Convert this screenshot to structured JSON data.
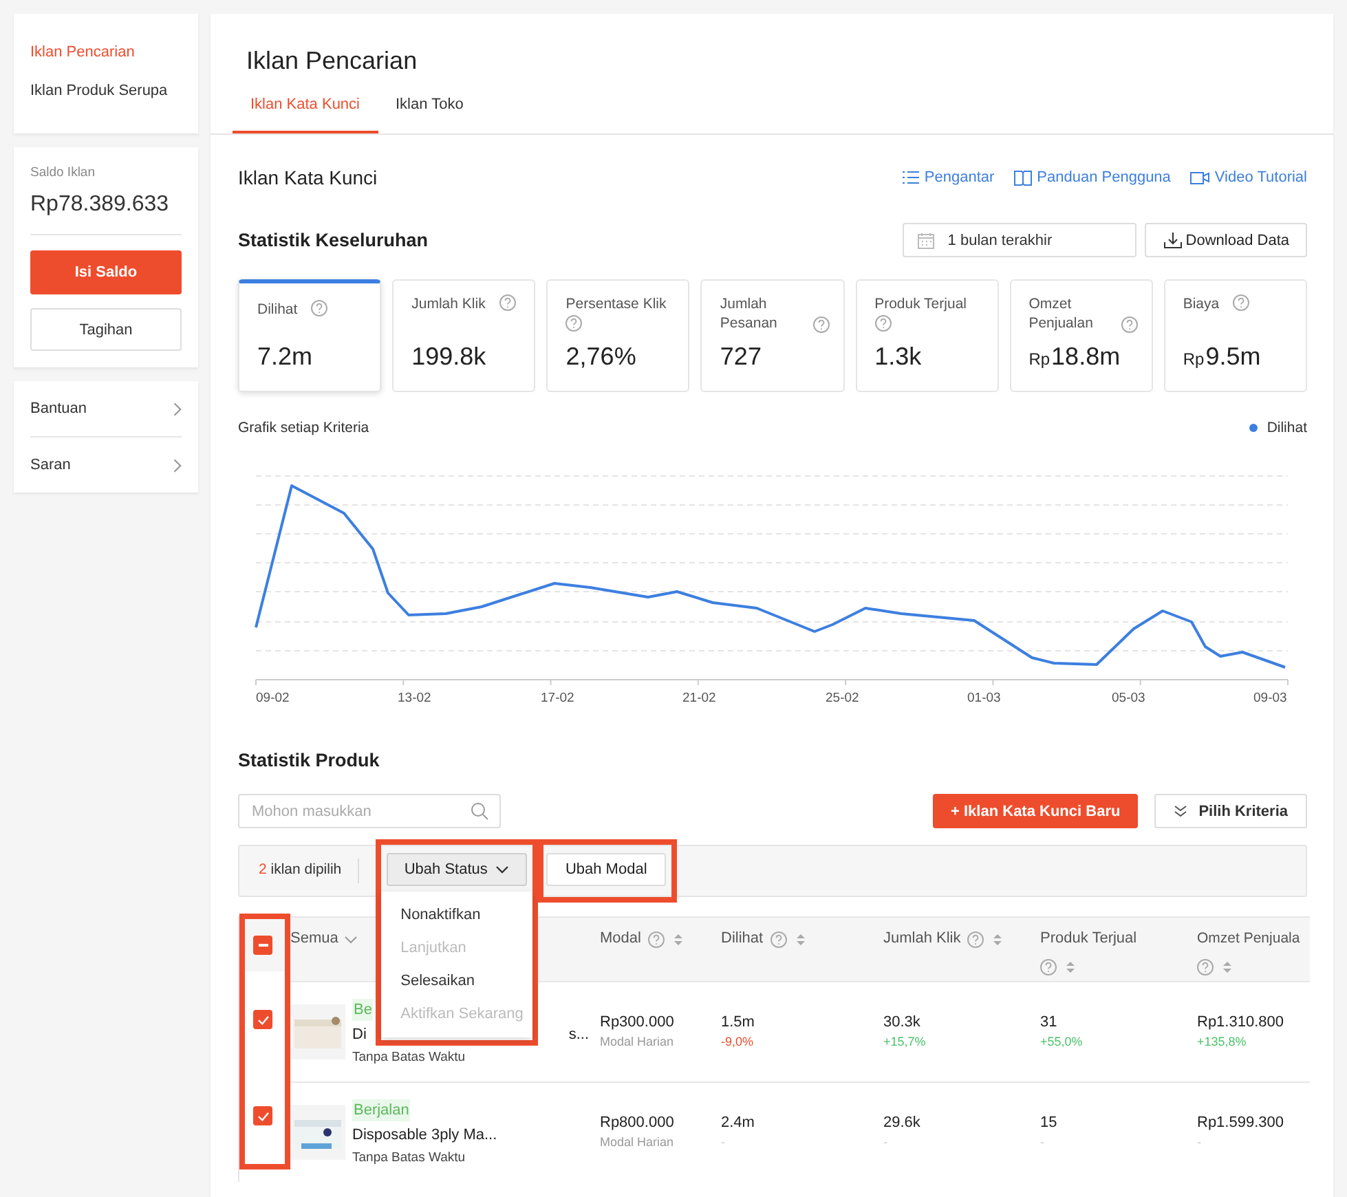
{
  "sidebar": {
    "menu": [
      {
        "label": "Iklan Pencarian",
        "selected": true
      },
      {
        "label": "Iklan Produk Serupa",
        "selected": false
      }
    ],
    "balance_label": "Saldo Iklan",
    "balance": "Rp78.389.633",
    "topup_button": "Isi Saldo",
    "invoice_button": "Tagihan",
    "links": [
      {
        "label": "Bantuan"
      },
      {
        "label": "Saran"
      }
    ]
  },
  "page": {
    "title": "Iklan Pencarian",
    "tabs": [
      {
        "label": "Iklan Kata Kunci",
        "selected": true
      },
      {
        "label": "Iklan Toko",
        "selected": false
      }
    ]
  },
  "section": {
    "title": "Iklan Kata Kunci",
    "links": [
      {
        "kind": "list",
        "label": "Pengantar"
      },
      {
        "kind": "book",
        "label": "Panduan Pengguna"
      },
      {
        "kind": "video",
        "label": "Video Tutorial"
      }
    ]
  },
  "overview": {
    "title": "Statistik Keseluruhan",
    "date_range": "1 bulan terakhir",
    "download_button": "Download Data",
    "metrics": [
      {
        "label": "Dilihat",
        "value": "7.2m",
        "selected": true
      },
      {
        "label": "Jumlah Klik",
        "value": "199.8k",
        "selected": false
      },
      {
        "label": "Persentase Klik",
        "value": "2,76%",
        "selected": false
      },
      {
        "label": "Jumlah Pesanan",
        "value": "727",
        "selected": false
      },
      {
        "label": "Produk Terjual",
        "value": "1.3k",
        "selected": false
      },
      {
        "label": "Omzet Penjualan",
        "currency": "Rp",
        "value": "18.8m",
        "selected": false
      },
      {
        "label": "Biaya",
        "currency": "Rp",
        "value": "9.5m",
        "selected": false
      }
    ]
  },
  "chart": {
    "title": "Grafik setiap Kriteria",
    "legend": "Dilihat",
    "x_labels": [
      "09-02",
      "13-02",
      "17-02",
      "21-02",
      "25-02",
      "01-03",
      "05-03",
      "09-03"
    ]
  },
  "products": {
    "title": "Statistik Produk",
    "search": {
      "placeholder": "Mohon masukkan"
    },
    "new_button": "+ Iklan Kata Kunci Baru",
    "criteria_button": "Pilih Kriteria",
    "selection": {
      "count": "2",
      "text": "iklan dipilih"
    },
    "status_button": {
      "label": "Ubah Status",
      "expanded": true,
      "highlighted": true
    },
    "budget_button": {
      "label": "Ubah Modal",
      "highlighted": true
    },
    "status_menu": [
      {
        "label": "Nonaktifkan",
        "disabled": false
      },
      {
        "label": "Lanjutkan",
        "disabled": true
      },
      {
        "label": "Selesaikan",
        "disabled": false
      },
      {
        "label": "Aktifkan Sekarang",
        "disabled": true
      }
    ],
    "table": {
      "select_all_indeterminate": true,
      "checkbox_column_highlighted": true,
      "product_header": "Semua",
      "columns": [
        {
          "label": "Modal",
          "help": true,
          "sortable": true
        },
        {
          "label": "Dilihat",
          "help": true,
          "sortable": true
        },
        {
          "label": "Jumlah Klik",
          "help": true,
          "sortable": true
        },
        {
          "label": "Produk Terjual",
          "help": true,
          "sortable": true
        },
        {
          "label": "Omzet Penjuala",
          "help": true,
          "sortable": true
        }
      ],
      "rows": [
        {
          "checked": true,
          "status": "Be",
          "name": "Di",
          "name_end": "s...",
          "duration": "Tanpa Batas Waktu",
          "cells": [
            {
              "value": "Rp300.000",
              "sub": "Modal Harian",
              "kind": "budget"
            },
            {
              "value": "1.5m",
              "sub": "-9,0%",
              "kind": "down"
            },
            {
              "value": "30.3k",
              "sub": "+15,7%",
              "kind": "up"
            },
            {
              "value": "31",
              "sub": "+55,0%",
              "kind": "up"
            },
            {
              "value": "Rp1.310.800",
              "sub": "+135,8%",
              "kind": "up"
            }
          ]
        },
        {
          "checked": true,
          "status": "Berjalan",
          "name": "Disposable 3ply Ma...",
          "duration": "Tanpa Batas Waktu",
          "cells": [
            {
              "value": "Rp800.000",
              "sub": "Modal Harian",
              "kind": "budget"
            },
            {
              "value": "2.4m",
              "sub": "-",
              "kind": "none"
            },
            {
              "value": "29.6k",
              "sub": "-",
              "kind": "none"
            },
            {
              "value": "15",
              "sub": "-",
              "kind": "none"
            },
            {
              "value": "Rp1.599.300",
              "sub": "-",
              "kind": "none"
            }
          ]
        }
      ]
    }
  }
}
